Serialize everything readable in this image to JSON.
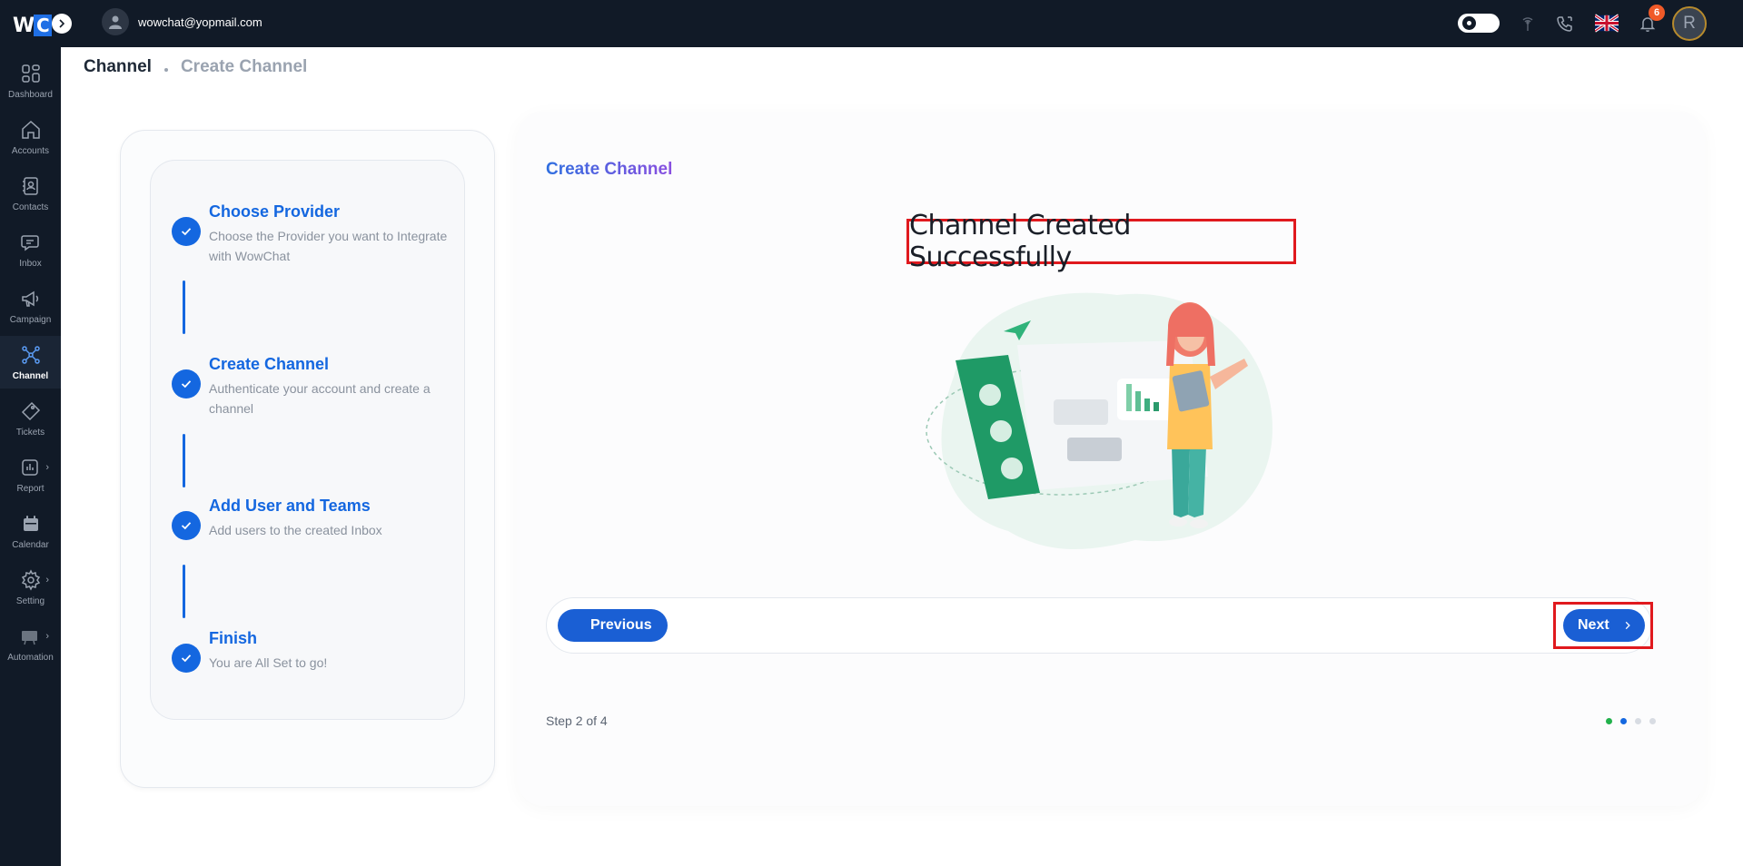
{
  "app": {
    "logo_w": "W",
    "logo_c": "C",
    "user_email": "wowchat@yopmail.com",
    "notification_count": "6",
    "profile_initial": "R",
    "accent": "#1467e0",
    "highlight": "#e0191e"
  },
  "sidebar": {
    "items": [
      {
        "label": "Dashboard",
        "icon": "dashboard-icon"
      },
      {
        "label": "Accounts",
        "icon": "home-icon"
      },
      {
        "label": "Contacts",
        "icon": "contact-book-icon"
      },
      {
        "label": "Inbox",
        "icon": "chat-bubbles-icon"
      },
      {
        "label": "Campaign",
        "icon": "megaphone-icon"
      },
      {
        "label": "Channel",
        "icon": "network-icon",
        "active": true
      },
      {
        "label": "Tickets",
        "icon": "ticket-icon"
      },
      {
        "label": "Report",
        "icon": "report-icon"
      },
      {
        "label": "Calendar",
        "icon": "calendar-icon"
      },
      {
        "label": "Setting",
        "icon": "gear-icon"
      },
      {
        "label": "Automation",
        "icon": "automation-icon"
      }
    ]
  },
  "breadcrumb": {
    "main": "Channel",
    "sub": "Create Channel"
  },
  "stepper": {
    "steps": [
      {
        "title": "Choose Provider",
        "desc": "Choose the Provider you want to Integrate with WowChat"
      },
      {
        "title": "Create Channel",
        "desc": "Authenticate your account and create a channel"
      },
      {
        "title": "Add User and Teams",
        "desc": "Add users to the created Inbox"
      },
      {
        "title": "Finish",
        "desc": "You are All Set to go!"
      }
    ]
  },
  "main": {
    "card_title": "Create Channel",
    "success_message": "Channel Created Successfully",
    "previous_label": "Previous",
    "next_label": "Next",
    "step_indicator": "Step 2 of 4",
    "dots_colors": [
      "#22b14c",
      "#1467e0",
      "#d8dce3",
      "#d8dce3"
    ]
  }
}
